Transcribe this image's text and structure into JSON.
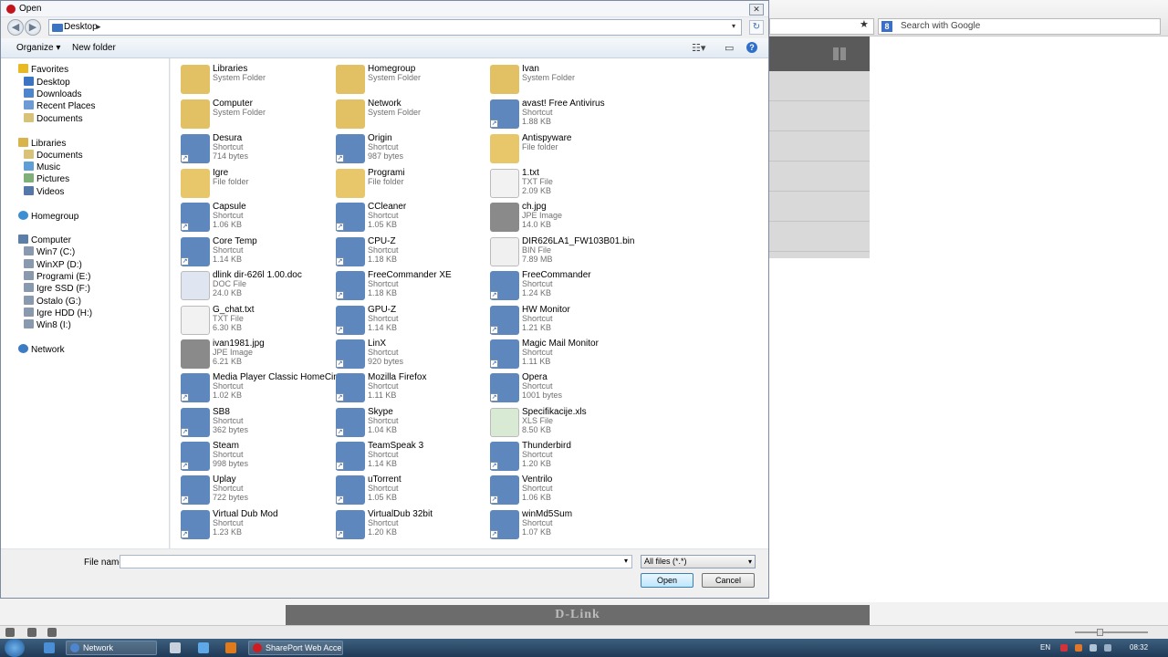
{
  "browser": {
    "search_placeholder": "Search with Google",
    "footer_logo": "D-Link"
  },
  "dialog": {
    "title": "Open",
    "close_label": "✕",
    "path": "Desktop",
    "organize_label": "Organize ▾",
    "new_folder_label": "New folder",
    "filename_label": "File name:",
    "filename_value": "",
    "filetype_value": "All files (*.*)",
    "open_label": "Open",
    "cancel_label": "Cancel"
  },
  "nav": {
    "favorites": "Favorites",
    "desktop": "Desktop",
    "downloads": "Downloads",
    "recent": "Recent Places",
    "documents": "Documents",
    "libraries": "Libraries",
    "lib_documents": "Documents",
    "music": "Music",
    "pictures": "Pictures",
    "videos": "Videos",
    "homegroup": "Homegroup",
    "computer": "Computer",
    "drive_c": "Win7 (C:)",
    "drive_d": "WinXP (D:)",
    "drive_e": "Programi (E:)",
    "drive_f": "Igre SSD (F:)",
    "drive_g": "Ostalo (G:)",
    "drive_h": "Igre HDD (H:)",
    "drive_i": "Win8 (I:)",
    "network": "Network"
  },
  "files": [
    {
      "name": "Libraries",
      "type": "System Folder",
      "size": ""
    },
    {
      "name": "Computer",
      "type": "System Folder",
      "size": ""
    },
    {
      "name": "Desura",
      "type": "Shortcut",
      "size": "714 bytes"
    },
    {
      "name": "Igre",
      "type": "File folder",
      "size": ""
    },
    {
      "name": "Capsule",
      "type": "Shortcut",
      "size": "1.06 KB"
    },
    {
      "name": "Core Temp",
      "type": "Shortcut",
      "size": "1.14 KB"
    },
    {
      "name": "dlink dir-626l 1.00.doc",
      "type": "DOC File",
      "size": "24.0 KB"
    },
    {
      "name": "G_chat.txt",
      "type": "TXT File",
      "size": "6.30 KB"
    },
    {
      "name": "ivan1981.jpg",
      "type": "JPE Image",
      "size": "6.21 KB"
    },
    {
      "name": "Media Player Classic HomeCinema",
      "type": "Shortcut",
      "size": "1.02 KB"
    },
    {
      "name": "SB8",
      "type": "Shortcut",
      "size": "362 bytes"
    },
    {
      "name": "Steam",
      "type": "Shortcut",
      "size": "998 bytes"
    },
    {
      "name": "Uplay",
      "type": "Shortcut",
      "size": "722 bytes"
    },
    {
      "name": "Virtual Dub Mod",
      "type": "Shortcut",
      "size": "1.23 KB"
    },
    {
      "name": "Homegroup",
      "type": "System Folder",
      "size": ""
    },
    {
      "name": "Network",
      "type": "System Folder",
      "size": ""
    },
    {
      "name": "Origin",
      "type": "Shortcut",
      "size": "987 bytes"
    },
    {
      "name": "Programi",
      "type": "File folder",
      "size": ""
    },
    {
      "name": "CCleaner",
      "type": "Shortcut",
      "size": "1.05 KB"
    },
    {
      "name": "CPU-Z",
      "type": "Shortcut",
      "size": "1.18 KB"
    },
    {
      "name": "FreeCommander XE",
      "type": "Shortcut",
      "size": "1.18 KB"
    },
    {
      "name": "GPU-Z",
      "type": "Shortcut",
      "size": "1.14 KB"
    },
    {
      "name": "LinX",
      "type": "Shortcut",
      "size": "920 bytes"
    },
    {
      "name": "Mozilla Firefox",
      "type": "Shortcut",
      "size": "1.11 KB"
    },
    {
      "name": "Skype",
      "type": "Shortcut",
      "size": "1.04 KB"
    },
    {
      "name": "TeamSpeak 3",
      "type": "Shortcut",
      "size": "1.14 KB"
    },
    {
      "name": "uTorrent",
      "type": "Shortcut",
      "size": "1.05 KB"
    },
    {
      "name": "VirtualDub 32bit",
      "type": "Shortcut",
      "size": "1.20 KB"
    },
    {
      "name": "Ivan",
      "type": "System Folder",
      "size": ""
    },
    {
      "name": "avast! Free Antivirus",
      "type": "Shortcut",
      "size": "1.88 KB"
    },
    {
      "name": "Antispyware",
      "type": "File folder",
      "size": ""
    },
    {
      "name": "1.txt",
      "type": "TXT File",
      "size": "2.09 KB"
    },
    {
      "name": "ch.jpg",
      "type": "JPE Image",
      "size": "14.0 KB"
    },
    {
      "name": "DIR626LA1_FW103B01.bin",
      "type": "BIN File",
      "size": "7.89 MB"
    },
    {
      "name": "FreeCommander",
      "type": "Shortcut",
      "size": "1.24 KB"
    },
    {
      "name": "HW Monitor",
      "type": "Shortcut",
      "size": "1.21 KB"
    },
    {
      "name": "Magic Mail Monitor",
      "type": "Shortcut",
      "size": "1.11 KB"
    },
    {
      "name": "Opera",
      "type": "Shortcut",
      "size": "1001 bytes"
    },
    {
      "name": "Specifikacije.xls",
      "type": "XLS File",
      "size": "8.50 KB"
    },
    {
      "name": "Thunderbird",
      "type": "Shortcut",
      "size": "1.20 KB"
    },
    {
      "name": "Ventrilo",
      "type": "Shortcut",
      "size": "1.06 KB"
    },
    {
      "name": "winMd5Sum",
      "type": "Shortcut",
      "size": "1.07 KB"
    }
  ],
  "taskbar": {
    "task_network": "Network",
    "task_sharepoint": "SharePort Web Acce...",
    "lang": "EN",
    "clock": "08:32"
  }
}
